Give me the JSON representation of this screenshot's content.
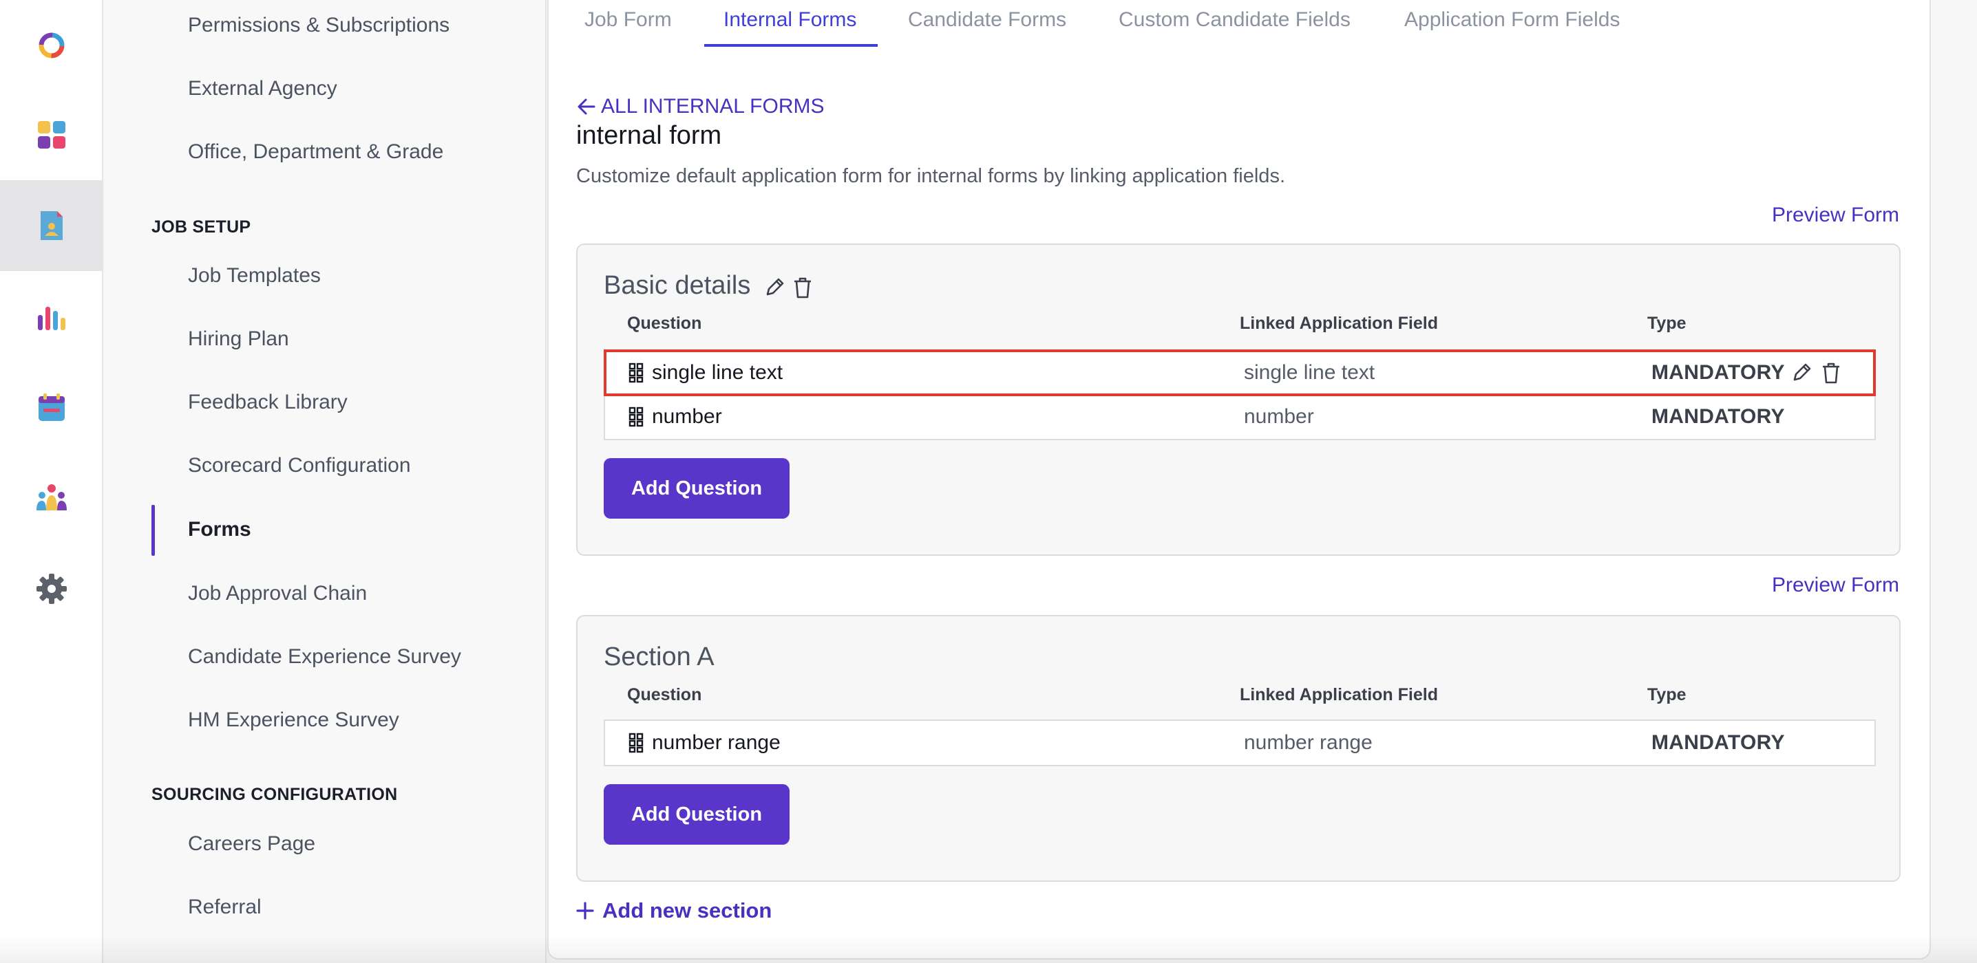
{
  "rail": {
    "items": [
      {
        "icon": "app-logo-icon"
      },
      {
        "icon": "dashboard-icon"
      },
      {
        "icon": "jobs-document-icon"
      },
      {
        "icon": "reports-bar-chart-icon"
      },
      {
        "icon": "calendar-icon"
      },
      {
        "icon": "people-group-icon"
      },
      {
        "icon": "settings-gear-icon"
      }
    ],
    "active_index": 2
  },
  "sidebar": {
    "top_items": [
      "Permissions & Subscriptions",
      "External Agency",
      "Office, Department & Grade"
    ],
    "job_setup": {
      "heading": "JOB SETUP",
      "items": [
        "Job Templates",
        "Hiring Plan",
        "Feedback Library",
        "Scorecard Configuration",
        "Forms",
        "Job Approval Chain",
        "Candidate Experience Survey",
        "HM Experience Survey"
      ],
      "active": "Forms"
    },
    "sourcing": {
      "heading": "SOURCING CONFIGURATION",
      "items": [
        "Careers Page",
        "Referral"
      ]
    }
  },
  "tabs": [
    {
      "label": "Job Form"
    },
    {
      "label": "Internal Forms",
      "active": true
    },
    {
      "label": "Candidate Forms"
    },
    {
      "label": "Custom Candidate Fields"
    },
    {
      "label": "Application Form Fields"
    }
  ],
  "header": {
    "back_label": "ALL INTERNAL FORMS",
    "title": "internal form",
    "description": "Customize default application form for internal forms by linking application fields."
  },
  "preview_label": "Preview Form",
  "columns": {
    "question": "Question",
    "linked": "Linked Application Field",
    "type": "Type"
  },
  "sections": [
    {
      "title": "Basic details",
      "editable": true,
      "rows": [
        {
          "question": "single line text",
          "linked": "single line text",
          "type": "MANDATORY",
          "highlighted": true
        },
        {
          "question": "number",
          "linked": "number",
          "type": "MANDATORY"
        }
      ],
      "add_label": "Add Question"
    },
    {
      "title": "Section A",
      "editable": false,
      "rows": [
        {
          "question": "number range",
          "linked": "number range",
          "type": "MANDATORY"
        }
      ],
      "add_label": "Add Question"
    }
  ],
  "add_section_label": "Add new section",
  "colors": {
    "accent": "#5a35c9",
    "tab_active": "#3f3fd8",
    "highlight": "#e03a2f"
  }
}
